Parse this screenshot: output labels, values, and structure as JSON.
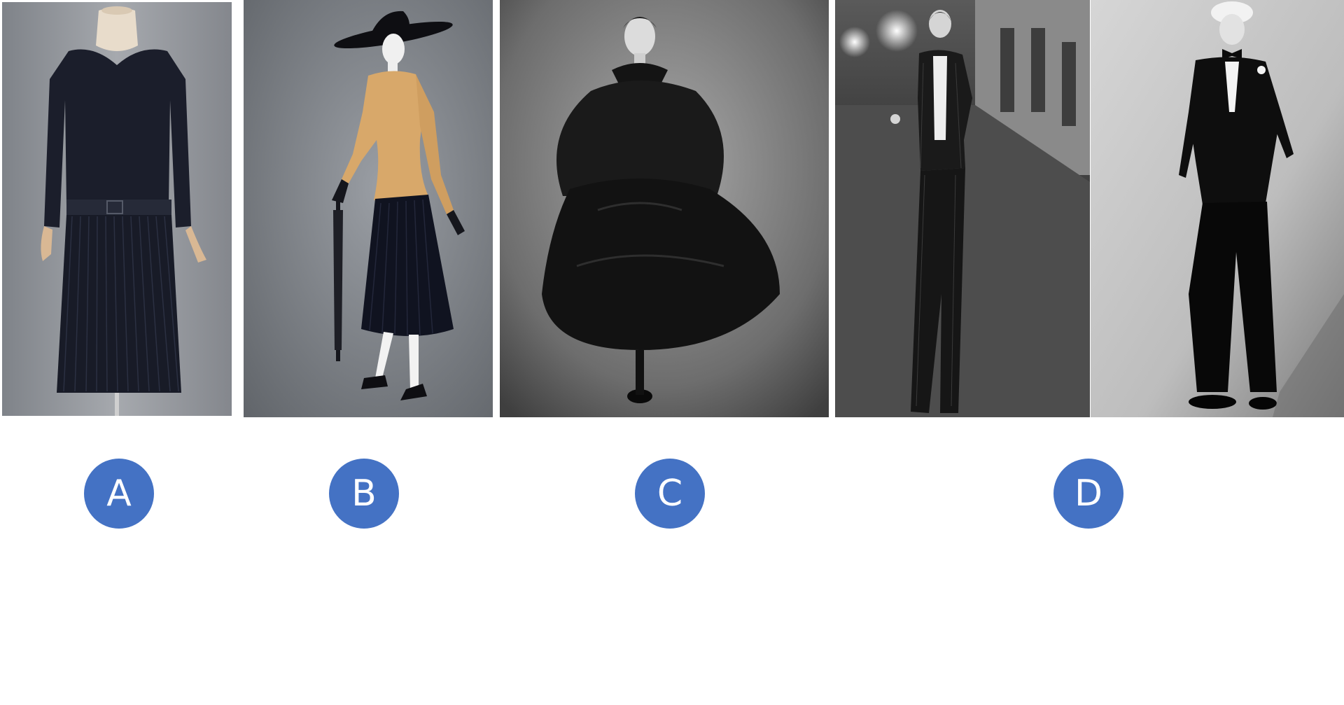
{
  "labels": {
    "a": "A",
    "b": "B",
    "c": "C",
    "d": "D"
  },
  "colors": {
    "badge_fill": "#4472c4",
    "badge_text": "#ffffff",
    "page_background": "#ffffff"
  },
  "images": [
    {
      "label": "A",
      "style": "color"
    },
    {
      "label": "B",
      "style": "color"
    },
    {
      "label": "C",
      "style": "black-and-white"
    },
    {
      "label": "D",
      "style": "black-and-white"
    },
    {
      "label": "D",
      "style": "black-and-white"
    }
  ]
}
